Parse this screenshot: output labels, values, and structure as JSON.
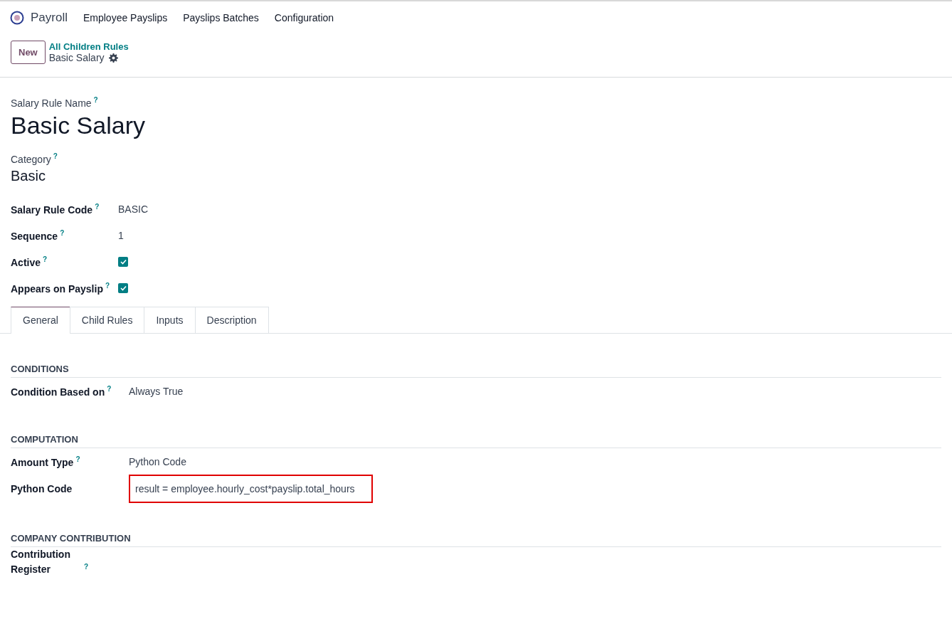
{
  "navbar": {
    "app_name": "Payroll",
    "menu": [
      "Employee Payslips",
      "Payslips Batches",
      "Configuration"
    ]
  },
  "control_panel": {
    "new_button": "New",
    "breadcrumb": "All Children Rules",
    "record": "Basic Salary"
  },
  "form": {
    "name_label": "Salary Rule Name",
    "name_help": "?",
    "name": "Basic Salary",
    "category_label": "Category",
    "category_help": "?",
    "category": "Basic",
    "fields": [
      {
        "kind": "text",
        "label": "Salary Rule Code",
        "help": "?",
        "value": "BASIC"
      },
      {
        "kind": "text",
        "label": "Sequence",
        "help": "?",
        "value": "1"
      },
      {
        "kind": "checkbox",
        "label": "Active",
        "help": "?",
        "checked": true
      },
      {
        "kind": "checkbox",
        "label": "Appears on Payslip",
        "help": "?",
        "checked": true
      }
    ],
    "tabs": [
      {
        "label": "General",
        "selected": true
      },
      {
        "label": "Child Rules",
        "selected": false
      },
      {
        "label": "Inputs",
        "selected": false
      },
      {
        "label": "Description",
        "selected": false
      }
    ],
    "sections": [
      {
        "title": "CONDITIONS",
        "fields": [
          {
            "kind": "text",
            "label": "Condition Based on",
            "help": "?",
            "value": "Always True"
          }
        ]
      },
      {
        "title": "COMPUTATION",
        "fields": [
          {
            "kind": "text",
            "label": "Amount Type",
            "help": "?",
            "value": "Python Code"
          },
          {
            "kind": "code",
            "label": "Python Code",
            "value": "result = employee.hourly_cost*payslip.total_hours",
            "highlighted": true
          }
        ]
      },
      {
        "title": "COMPANY CONTRIBUTION",
        "fields": [
          {
            "kind": "empty",
            "label": "Contribution Register",
            "help": "?"
          }
        ]
      }
    ]
  }
}
